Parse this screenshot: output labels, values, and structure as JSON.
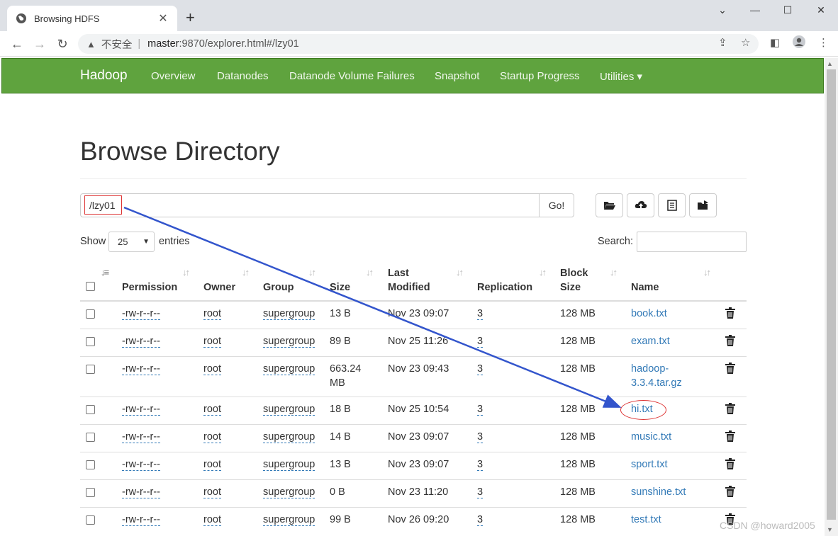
{
  "browser": {
    "tab_title": "Browsing HDFS",
    "insecure_label": "不安全",
    "url_host": "master",
    "url_path": ":9870/explorer.html#/lzy01"
  },
  "navbar": {
    "brand": "Hadoop",
    "links": [
      "Overview",
      "Datanodes",
      "Datanode Volume Failures",
      "Snapshot",
      "Startup Progress",
      "Utilities ▾"
    ]
  },
  "page": {
    "title": "Browse Directory",
    "path_value": "/lzy01",
    "go_label": "Go!",
    "show_label": "Show",
    "show_value": "25",
    "entries_label": "entries",
    "search_label": "Search:"
  },
  "table": {
    "headers": {
      "permission": "Permission",
      "owner": "Owner",
      "group": "Group",
      "size": "Size",
      "last_modified_1": "Last",
      "last_modified_2": "Modified",
      "replication": "Replication",
      "block_size_1": "Block",
      "block_size_2": "Size",
      "name": "Name"
    },
    "rows": [
      {
        "permission": "-rw-r--r--",
        "owner": "root",
        "group": "supergroup",
        "size": "13 B",
        "size2": "",
        "modified": "Nov 23 09:07",
        "replication": "3",
        "block": "128 MB",
        "name": "book.txt",
        "name2": ""
      },
      {
        "permission": "-rw-r--r--",
        "owner": "root",
        "group": "supergroup",
        "size": "89 B",
        "size2": "",
        "modified": "Nov 25 11:26",
        "replication": "3",
        "block": "128 MB",
        "name": "exam.txt",
        "name2": ""
      },
      {
        "permission": "-rw-r--r--",
        "owner": "root",
        "group": "supergroup",
        "size": "663.24",
        "size2": "MB",
        "modified": "Nov 23 09:43",
        "replication": "3",
        "block": "128 MB",
        "name": "hadoop-",
        "name2": "3.3.4.tar.gz"
      },
      {
        "permission": "-rw-r--r--",
        "owner": "root",
        "group": "supergroup",
        "size": "18 B",
        "size2": "",
        "modified": "Nov 25 10:54",
        "replication": "3",
        "block": "128 MB",
        "name": "hi.txt",
        "name2": ""
      },
      {
        "permission": "-rw-r--r--",
        "owner": "root",
        "group": "supergroup",
        "size": "14 B",
        "size2": "",
        "modified": "Nov 23 09:07",
        "replication": "3",
        "block": "128 MB",
        "name": "music.txt",
        "name2": ""
      },
      {
        "permission": "-rw-r--r--",
        "owner": "root",
        "group": "supergroup",
        "size": "13 B",
        "size2": "",
        "modified": "Nov 23 09:07",
        "replication": "3",
        "block": "128 MB",
        "name": "sport.txt",
        "name2": ""
      },
      {
        "permission": "-rw-r--r--",
        "owner": "root",
        "group": "supergroup",
        "size": "0 B",
        "size2": "",
        "modified": "Nov 23 11:20",
        "replication": "3",
        "block": "128 MB",
        "name": "sunshine.txt",
        "name2": ""
      },
      {
        "permission": "-rw-r--r--",
        "owner": "root",
        "group": "supergroup",
        "size": "99 B",
        "size2": "",
        "modified": "Nov 26 09:20",
        "replication": "3",
        "block": "128 MB",
        "name": "test.txt",
        "name2": ""
      }
    ]
  },
  "watermark": "CSDN @howard2005",
  "colors": {
    "navbar": "#5fa33e",
    "link": "#337ab7",
    "annotation": "#d33",
    "arrow": "#3355cc"
  }
}
